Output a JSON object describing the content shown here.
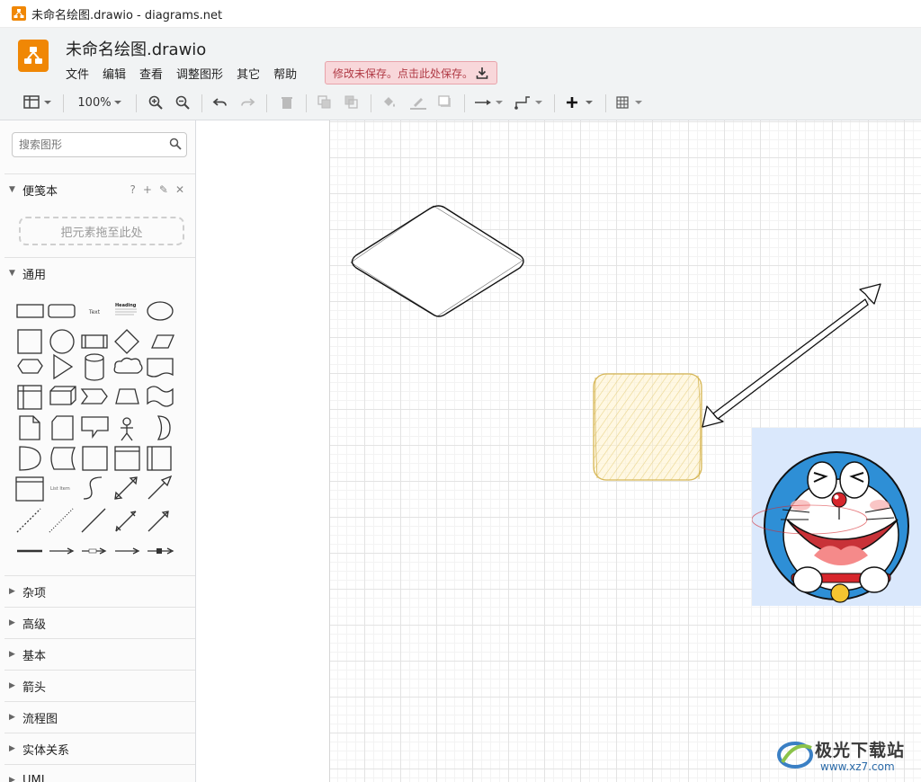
{
  "window": {
    "title": "未命名绘图.drawio - diagrams.net"
  },
  "header": {
    "filename": "未命名绘图.drawio",
    "menu": [
      "文件",
      "编辑",
      "查看",
      "调整图形",
      "其它",
      "帮助"
    ],
    "unsaved_notice": "修改未保存。点击此处保存。"
  },
  "toolbar": {
    "zoom": "100%",
    "icons": [
      "format-panel-icon",
      "zoom-in-icon",
      "zoom-out-icon",
      "undo-icon",
      "redo-icon",
      "delete-icon",
      "to-front-icon",
      "to-back-icon",
      "fill-color-icon",
      "line-color-icon",
      "shadow-icon",
      "connection-icon",
      "waypoints-icon",
      "insert-icon",
      "table-icon"
    ]
  },
  "sidebar": {
    "search_placeholder": "搜索图形",
    "scratchpad": {
      "title": "便笺本",
      "help": "?",
      "dropzone": "把元素拖至此处"
    },
    "general": {
      "title": "通用",
      "text_shape_label": "Text",
      "heading_shape_label": "Heading",
      "list_item_label": "List Item"
    },
    "collapsed_sections": [
      "杂项",
      "高级",
      "基本",
      "箭头",
      "流程图",
      "实体关系",
      "UML"
    ]
  },
  "canvas": {
    "shapes": [
      "rounded-diamond",
      "sketch-rectangle-yellow",
      "bidirectional-sketch-arrow",
      "doraemon-image"
    ],
    "colors": {
      "sketch_fill": "#fff2cc",
      "sketch_stroke": "#d6b656",
      "image_bg": "#dae8fc"
    }
  },
  "watermark": {
    "text": "极光下载站",
    "url": "www.xz7.com"
  }
}
